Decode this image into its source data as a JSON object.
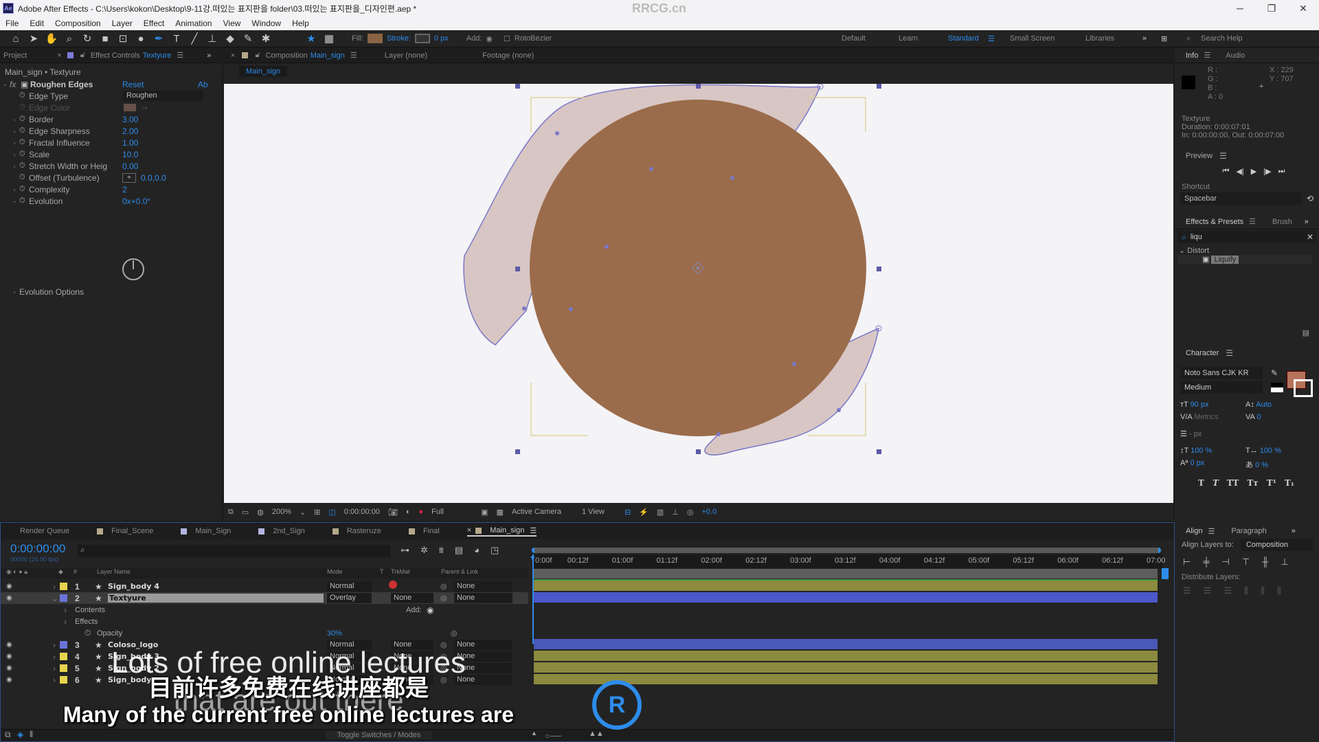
{
  "titlebar": {
    "app_icon": "Ae",
    "title": "Adobe After Effects - C:\\Users\\kokon\\Desktop\\9-11강.떠있는 표지판을 folder\\03.떠있는 표지판을_디자인편.aep *",
    "watermark": "RRCG.cn",
    "minimize": "─",
    "restore": "❐",
    "close": "✕"
  },
  "menu": [
    "File",
    "Edit",
    "Composition",
    "Layer",
    "Effect",
    "Animation",
    "View",
    "Window",
    "Help"
  ],
  "toolbar": {
    "fill_label": "Fill:",
    "fill_color": "#8b6343",
    "stroke_label": "Stroke:",
    "stroke_width": "0 px",
    "add_label": "Add:",
    "rotobezier_label": "RotoBezier",
    "workspaces": [
      "Default",
      "Learn",
      "Standard",
      "Small Screen",
      "Libraries"
    ],
    "active_workspace": "Standard",
    "search_help": "Search Help"
  },
  "effect_controls": {
    "project_tab": "Project",
    "tab_label": "Effect Controls",
    "tab_layer": "Textyure",
    "breadcrumb": "Main_sign • Textyure",
    "effect_name": "Roughen Edges",
    "reset": "Reset",
    "about": "Ab",
    "properties": [
      {
        "name": "Edge Type",
        "value": "Roughen",
        "type": "dropdown"
      },
      {
        "name": "Edge Color",
        "value": "",
        "type": "color",
        "disabled": true,
        "color": "#e3a48a"
      },
      {
        "name": "Border",
        "value": "3.00"
      },
      {
        "name": "Edge Sharpness",
        "value": "2.00"
      },
      {
        "name": "Fractal Influence",
        "value": "1.00"
      },
      {
        "name": "Scale",
        "value": "10.0"
      },
      {
        "name": "Stretch Width or Heig",
        "value": "0.00"
      },
      {
        "name": "Offset (Turbulence)",
        "value": "0.0,0.0"
      },
      {
        "name": "Complexity",
        "value": "2"
      },
      {
        "name": "Evolution",
        "value": "0x+0.0°"
      }
    ],
    "evolution_options": "Evolution Options"
  },
  "composition": {
    "tab_label": "Composition",
    "tab_name": "Main_sign",
    "layer_tab": "Layer (none)",
    "footage_tab": "Footage (none)",
    "comp_name_chip": "Main_sign",
    "circle_color": "#9b6c4b",
    "shape_fill": "#d8c6c4",
    "shape_stroke": "#7b78c8",
    "bottom": {
      "zoom": "200%",
      "timecode": "0:00:00:00",
      "resolution": "Full",
      "camera": "Active Camera",
      "views": "1 View",
      "exposure": "+0.0"
    }
  },
  "info": {
    "tab": "Info",
    "audio_tab": "Audio",
    "r": "R :",
    "g": "G :",
    "b": "B :",
    "a": "A : 0",
    "x": "X : 229",
    "y": "Y : 707",
    "layer": "Textyure",
    "duration": "Duration: 0:00:07:01",
    "inout": "In: 0:00:00:00, Out: 0:00:07:00"
  },
  "preview": {
    "title": "Preview",
    "shortcut_label": "Shortcut",
    "shortcut_value": "Spacebar"
  },
  "effects_presets": {
    "title": "Effects & Presets",
    "brush_tab": "Brush",
    "search": "liqu",
    "category": "Distort",
    "item": "Liquify"
  },
  "character": {
    "title": "Character",
    "font": "Noto Sans CJK KR",
    "style": "Medium",
    "size": "90 px",
    "leading": "Auto",
    "kerning": "Metrics",
    "tracking": "0",
    "stroke": "- px",
    "vscale": "100 %",
    "hscale": "100 %",
    "baseline": "0 px",
    "tsume": "0 %",
    "fill_color": "#b5735a"
  },
  "align": {
    "title": "Align",
    "paragraph_tab": "Paragraph",
    "align_to_label": "Align Layers to:",
    "align_to_value": "Composition",
    "distribute_label": "Distribute Layers:"
  },
  "timeline": {
    "tabs": [
      {
        "label": "Render Queue",
        "color": ""
      },
      {
        "label": "Final_Scene",
        "color": "#b5a88a"
      },
      {
        "label": "Main_Sign",
        "color": "#b4b4e0"
      },
      {
        "label": "2nd_Sign",
        "color": "#b4b4e0"
      },
      {
        "label": "Rasteruze",
        "color": "#b5a88a"
      },
      {
        "label": "Final",
        "color": "#b5a88a"
      },
      {
        "label": "Main_sign",
        "color": "#b5a88a",
        "active": true
      }
    ],
    "timecode": "0:00:00:00",
    "fps": "00000 (24.00 fps)",
    "columns": {
      "layer_name": "Layer Name",
      "mode": "Mode",
      "t": "T",
      "trkmat": "TrkMat",
      "parent": "Parent & Link"
    },
    "ruler": [
      "0:00f",
      "00:12f",
      "01:00f",
      "01:12f",
      "02:00f",
      "02:12f",
      "03:00f",
      "03:12f",
      "04:00f",
      "04:12f",
      "05:00f",
      "05:12f",
      "06:00f",
      "06:12f",
      "07:00"
    ],
    "layers": [
      {
        "num": "1",
        "name": "Sign_body 4",
        "mode": "Normal",
        "trkmat": "",
        "parent": "None",
        "color": "#e6d34e",
        "bar": "#8c8a3e"
      },
      {
        "num": "2",
        "name": "Textyure",
        "mode": "Overlay",
        "trkmat": "None",
        "parent": "None",
        "color": "#6a74d8",
        "bar": "#4a58c8",
        "selected": true
      },
      {
        "num": "3",
        "name": "Coloso_logo",
        "mode": "Normal",
        "trkmat": "None",
        "parent": "None",
        "color": "#6a74d8",
        "bar": "#4a58b8"
      },
      {
        "num": "4",
        "name": "Sign_body 3",
        "mode": "Normal",
        "trkmat": "None",
        "parent": "None",
        "color": "#e6d34e",
        "bar": "#8c8a3e"
      },
      {
        "num": "5",
        "name": "Sign_body 2",
        "mode": "Normal",
        "trkmat": "None",
        "parent": "None",
        "color": "#e6d34e",
        "bar": "#8c8a3e"
      },
      {
        "num": "6",
        "name": "Sign_body",
        "mode": "Normal",
        "trkmat": "None",
        "parent": "None",
        "color": "#e6d34e",
        "bar": "#8c8a3e"
      }
    ],
    "sub": {
      "contents": "Contents",
      "effects": "Effects",
      "opacity": "Opacity",
      "opacity_value": "30%",
      "add": "Add:"
    },
    "toggle": "Toggle Switches / Modes"
  },
  "subtitles": {
    "english_original": "Lots of free online lectures",
    "english_original_2": "that are out there",
    "chinese": "目前许多免费在线讲座都是",
    "english": "Many of the current free online lectures are"
  }
}
